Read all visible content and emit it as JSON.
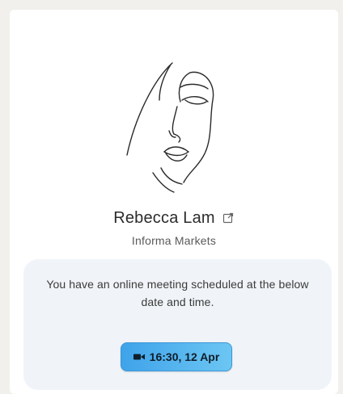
{
  "contact": {
    "name": "Rebecca Lam",
    "company": "Informa Markets",
    "avatar_icon": "line-art-face-icon",
    "profile_link_icon": "external-link-icon"
  },
  "meeting": {
    "message": "You have an online meeting scheduled at the below date and time.",
    "button_label": "16:30, 12 Apr",
    "button_icon": "video-camera-icon",
    "accent_color": "#4aaeef",
    "panel_color": "#f0f4f8"
  }
}
